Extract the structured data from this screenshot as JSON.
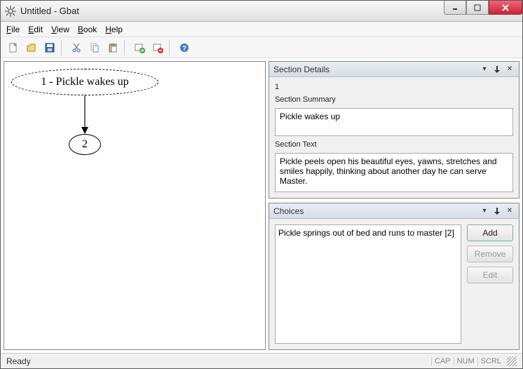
{
  "window": {
    "title": "Untitled - Gbat"
  },
  "menu": {
    "file": "File",
    "edit": "Edit",
    "view": "View",
    "book": "Book",
    "help": "Help"
  },
  "canvas": {
    "node1_label": "1 - Pickle wakes up",
    "node2_label": "2"
  },
  "section_details": {
    "title": "Section Details",
    "section_number": "1",
    "summary_label": "Section Summary",
    "summary_value": "Pickle wakes up",
    "text_label": "Section Text",
    "text_value": "Pickle peels open his beautiful eyes, yawns, stretches and smiles happily, thinking about another day he can serve Master."
  },
  "choices": {
    "title": "Choices",
    "items": [
      "Pickle springs out of bed and runs to master [2]"
    ],
    "add_label": "Add",
    "remove_label": "Remove",
    "edit_label": "Edit"
  },
  "status": {
    "ready": "Ready",
    "cap": "CAP",
    "num": "NUM",
    "scrl": "SCRL"
  }
}
